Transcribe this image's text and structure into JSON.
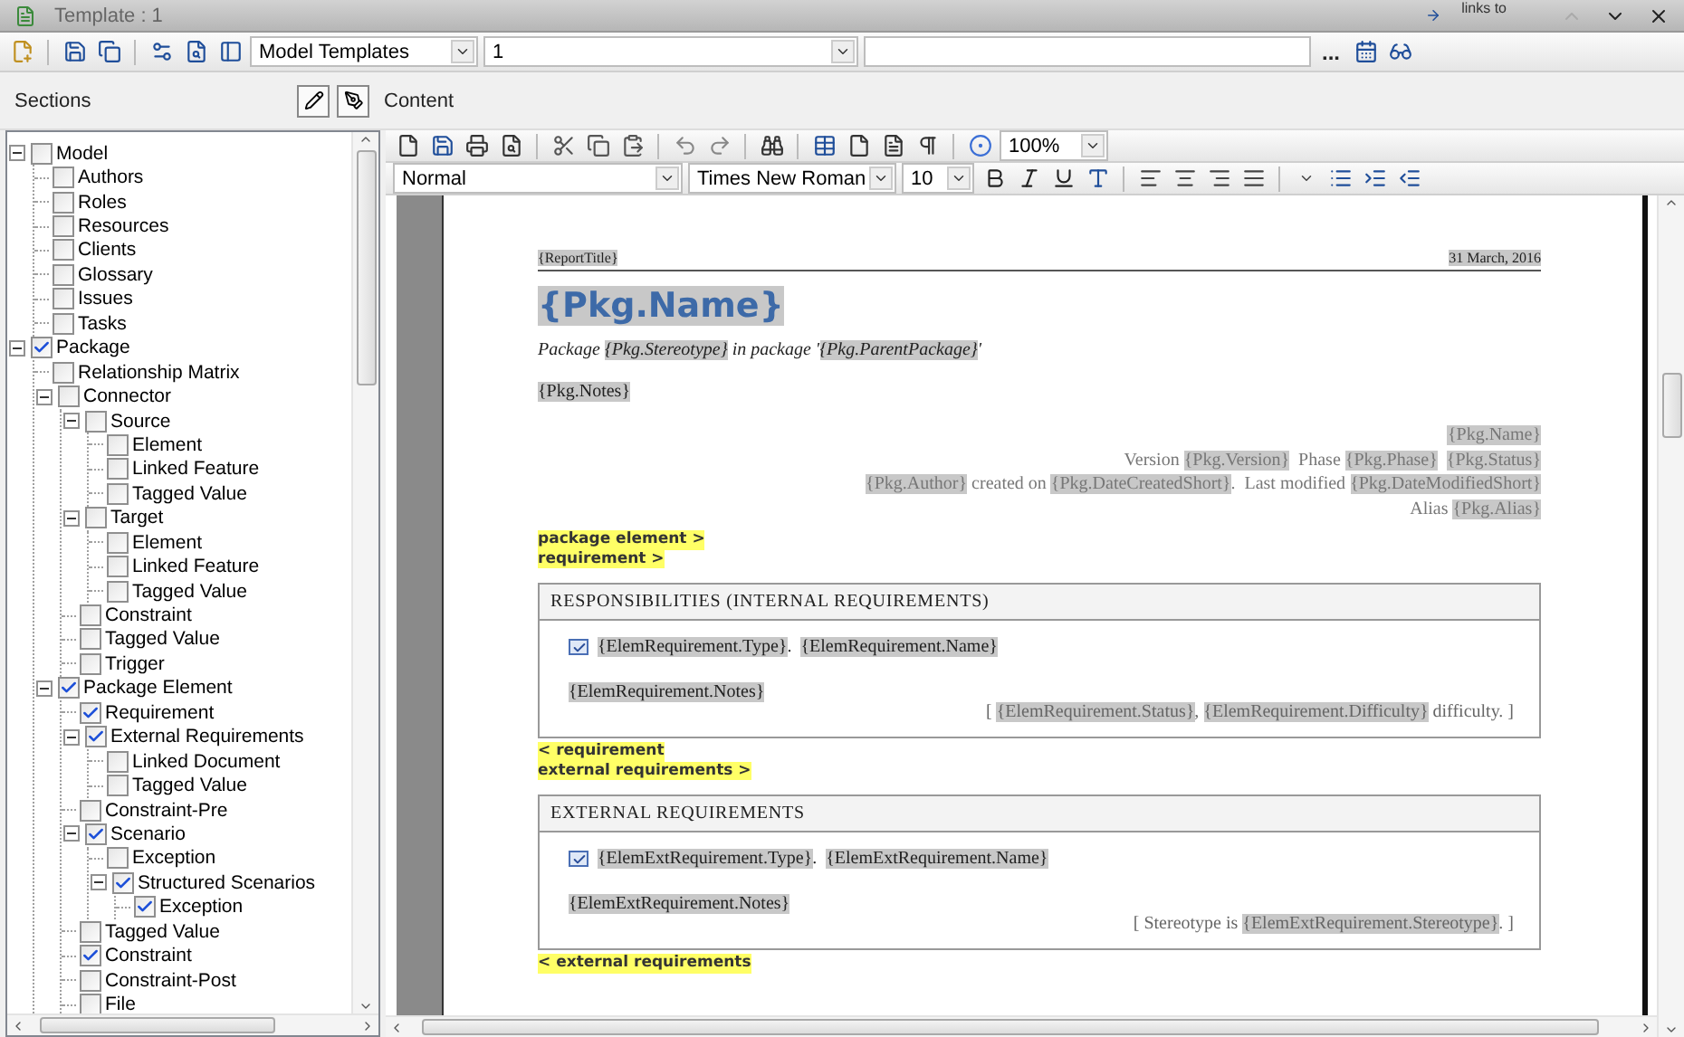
{
  "window": {
    "title": "Template : 1",
    "corner_link": "links to"
  },
  "toolbar": {
    "template_type": "Model Templates",
    "template_name": "1",
    "browse_button": "..."
  },
  "panels": {
    "sections_label": "Sections",
    "content_label": "Content"
  },
  "tree": [
    {
      "label": "Model",
      "checked": false,
      "expanded": true,
      "children": [
        {
          "label": "Authors",
          "checked": false
        },
        {
          "label": "Roles",
          "checked": false
        },
        {
          "label": "Resources",
          "checked": false
        },
        {
          "label": "Clients",
          "checked": false
        },
        {
          "label": "Glossary",
          "checked": false
        },
        {
          "label": "Issues",
          "checked": false
        },
        {
          "label": "Tasks",
          "checked": false
        }
      ]
    },
    {
      "label": "Package",
      "checked": true,
      "expanded": true,
      "children": [
        {
          "label": "Relationship Matrix",
          "checked": false
        },
        {
          "label": "Connector",
          "checked": false,
          "expanded": true,
          "children": [
            {
              "label": "Source",
              "checked": false,
              "expanded": true,
              "children": [
                {
                  "label": "Element",
                  "checked": false
                },
                {
                  "label": "Linked Feature",
                  "checked": false
                },
                {
                  "label": "Tagged Value",
                  "checked": false
                }
              ]
            },
            {
              "label": "Target",
              "checked": false,
              "expanded": true,
              "children": [
                {
                  "label": "Element",
                  "checked": false
                },
                {
                  "label": "Linked Feature",
                  "checked": false
                },
                {
                  "label": "Tagged Value",
                  "checked": false
                }
              ]
            },
            {
              "label": "Constraint",
              "checked": false
            },
            {
              "label": "Tagged Value",
              "checked": false
            },
            {
              "label": "Trigger",
              "checked": false
            }
          ]
        },
        {
          "label": "Package Element",
          "checked": true,
          "expanded": true,
          "children": [
            {
              "label": "Requirement",
              "checked": true
            },
            {
              "label": "External Requirements",
              "checked": true,
              "expanded": true,
              "children": [
                {
                  "label": "Linked Document",
                  "checked": false
                },
                {
                  "label": "Tagged Value",
                  "checked": false
                }
              ]
            },
            {
              "label": "Constraint-Pre",
              "checked": false
            },
            {
              "label": "Scenario",
              "checked": true,
              "expanded": true,
              "children": [
                {
                  "label": "Exception",
                  "checked": false
                },
                {
                  "label": "Structured Scenarios",
                  "checked": true,
                  "expanded": true,
                  "children": [
                    {
                      "label": "Exception",
                      "checked": true
                    }
                  ]
                }
              ]
            },
            {
              "label": "Tagged Value",
              "checked": false
            },
            {
              "label": "Constraint",
              "checked": true
            },
            {
              "label": "Constraint-Post",
              "checked": false
            },
            {
              "label": "File",
              "checked": false
            }
          ]
        }
      ]
    }
  ],
  "editor": {
    "zoom": "100%",
    "style": "Normal",
    "font": "Times New Roman",
    "size": "10"
  },
  "document": {
    "blocks": [
      {
        "kind": "header",
        "left": "{ReportTitle}",
        "right": "31 March, 2016"
      },
      {
        "kind": "title",
        "text": "{Pkg.Name}"
      },
      {
        "kind": "subtitle",
        "runs": [
          {
            "t": "Package ",
            "field": false
          },
          {
            "t": "{Pkg.Stereotype}",
            "field": true
          },
          {
            "t": " in package '",
            "field": false
          },
          {
            "t": "{Pkg.ParentPackage}",
            "field": true
          },
          {
            "t": "'",
            "field": false
          }
        ]
      },
      {
        "kind": "paragraph",
        "runs": [
          {
            "t": "{Pkg.Notes}",
            "field": true
          }
        ]
      },
      {
        "kind": "info",
        "lines": [
          [
            {
              "t": "{Pkg.Name}",
              "field": true
            }
          ],
          [
            {
              "t": "Version ",
              "field": false
            },
            {
              "t": "{Pkg.Version}",
              "field": true
            },
            {
              "t": "  Phase ",
              "field": false
            },
            {
              "t": "{Pkg.Phase}",
              "field": true
            },
            {
              "t": "{Pkg.Status}",
              "field": true
            }
          ],
          [
            {
              "t": "{Pkg.Author}",
              "field": true
            },
            {
              "t": " created on ",
              "field": false
            },
            {
              "t": "{Pkg.DateCreatedShort}",
              "field": true
            },
            {
              "t": ".  Last modified ",
              "field": false
            },
            {
              "t": "{Pkg.DateModifiedShort}",
              "field": true
            }
          ],
          [
            {
              "t": "Alias ",
              "field": false
            },
            {
              "t": "{Pkg.Alias}",
              "field": true
            }
          ]
        ]
      },
      {
        "kind": "marker",
        "text": "package element >"
      },
      {
        "kind": "marker",
        "text": "requirement >"
      },
      {
        "kind": "section",
        "heading": "RESPONSIBILITIES (INTERNAL REQUIREMENTS)",
        "item": [
          {
            "t": "{ElemRequirement.Type}",
            "field": true
          },
          {
            "t": ".  ",
            "field": false
          },
          {
            "t": "{ElemRequirement.Name}",
            "field": true
          }
        ],
        "notes": [
          {
            "t": "{ElemRequirement.Notes}",
            "field": true
          }
        ],
        "detail": [
          {
            "t": "[ ",
            "field": false
          },
          {
            "t": "{ElemRequirement.Status}",
            "field": true
          },
          {
            "t": ", ",
            "field": false
          },
          {
            "t": "{ElemRequirement.Difficulty}",
            "field": true
          },
          {
            "t": " difficulty. ]",
            "field": false
          }
        ]
      },
      {
        "kind": "marker",
        "text": "< requirement"
      },
      {
        "kind": "marker",
        "text": "external requirements >"
      },
      {
        "kind": "section",
        "heading": "EXTERNAL REQUIREMENTS",
        "item": [
          {
            "t": "{ElemExtRequirement.Type}",
            "field": true
          },
          {
            "t": ".  ",
            "field": false
          },
          {
            "t": "{ElemExtRequirement.Name}",
            "field": true
          }
        ],
        "notes": [
          {
            "t": "{ElemExtRequirement.Notes}",
            "field": true
          }
        ],
        "detail": [
          {
            "t": "[ Stereotype is ",
            "field": false
          },
          {
            "t": "{ElemExtRequirement.Stereotype}",
            "field": true
          },
          {
            "t": ". ]",
            "field": false
          }
        ]
      },
      {
        "kind": "marker",
        "text": "< external requirements"
      }
    ]
  }
}
